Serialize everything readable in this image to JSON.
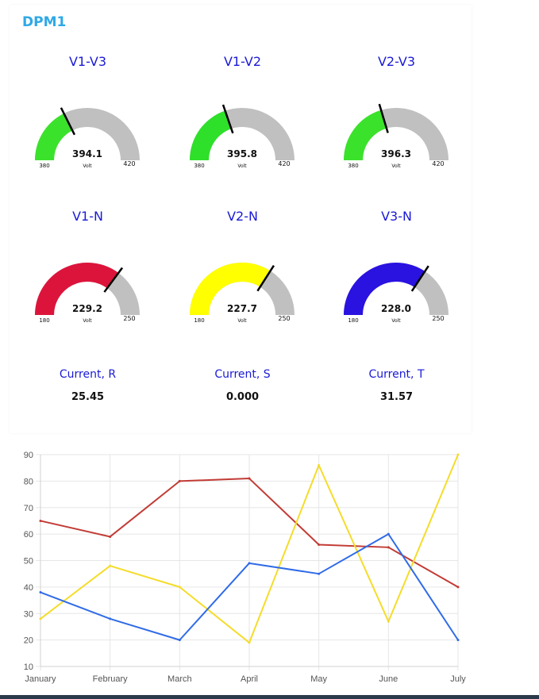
{
  "panel": {
    "title": "DPM1"
  },
  "gauges": [
    {
      "title": "V1-V3",
      "value": "394.1",
      "unit": "Volt",
      "min": "380",
      "max": "420",
      "min_num": 380,
      "max_num": 420,
      "value_num": 394.1,
      "color": "#3be22b"
    },
    {
      "title": "V1-V2",
      "value": "395.8",
      "unit": "Volt",
      "min": "380",
      "max": "420",
      "min_num": 380,
      "max_num": 420,
      "value_num": 395.8,
      "color": "#2ee02a"
    },
    {
      "title": "V2-V3",
      "value": "396.3",
      "unit": "Volt",
      "min": "380",
      "max": "420",
      "min_num": 380,
      "max_num": 420,
      "value_num": 396.3,
      "color": "#3be22b"
    },
    {
      "title": "V1-N",
      "value": "229.2",
      "unit": "Volt",
      "min": "180",
      "max": "250",
      "min_num": 180,
      "max_num": 250,
      "value_num": 229.2,
      "color": "#dc143c"
    },
    {
      "title": "V2-N",
      "value": "227.7",
      "unit": "Volt",
      "min": "180",
      "max": "250",
      "min_num": 180,
      "max_num": 250,
      "value_num": 227.7,
      "color": "#ffff00"
    },
    {
      "title": "V3-N",
      "value": "228.0",
      "unit": "Volt",
      "min": "180",
      "max": "250",
      "min_num": 180,
      "max_num": 250,
      "value_num": 228.0,
      "color": "#2a12e0"
    }
  ],
  "gauge_track_color": "#c0c0c0",
  "currents": [
    {
      "label": "Current, R",
      "value": "25.45"
    },
    {
      "label": "Current, S",
      "value": "0.000"
    },
    {
      "label": "Current, T",
      "value": "31.57"
    }
  ],
  "chart_data": {
    "type": "line",
    "title": "",
    "xlabel": "",
    "ylabel": "",
    "categories": [
      "January",
      "February",
      "March",
      "April",
      "May",
      "June",
      "July"
    ],
    "ylim": [
      10,
      90
    ],
    "yticks": [
      90,
      80,
      70,
      60,
      50,
      40,
      30,
      20,
      10
    ],
    "grid": true,
    "series": [
      {
        "values": [
          65,
          59,
          80,
          81,
          56,
          55,
          40
        ],
        "color": "#c23b35"
      },
      {
        "values": [
          28,
          48,
          40,
          19,
          86,
          27,
          90
        ],
        "color": "#f5dc2a"
      },
      {
        "values": [
          38,
          28,
          20,
          49,
          45,
          60,
          20
        ],
        "color": "#2f6be8"
      }
    ]
  }
}
